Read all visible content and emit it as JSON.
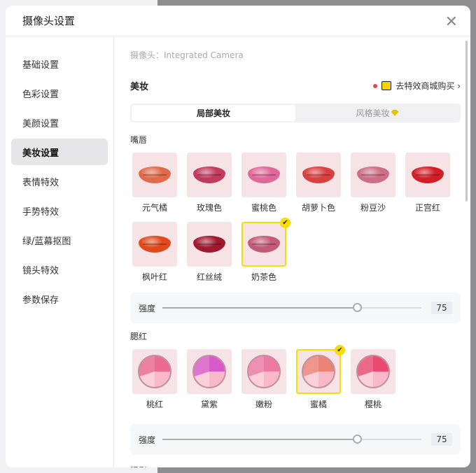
{
  "title": "摄像头设置",
  "sidebar": {
    "items": [
      {
        "label": "基础设置"
      },
      {
        "label": "色彩设置"
      },
      {
        "label": "美颜设置"
      },
      {
        "label": "美妆设置"
      },
      {
        "label": "表情特效"
      },
      {
        "label": "手势特效"
      },
      {
        "label": "绿/蓝幕抠图"
      },
      {
        "label": "镜头特效"
      },
      {
        "label": "参数保存"
      }
    ],
    "active": 3
  },
  "camera": "摄像头：Integrated Camera",
  "section_title": "美妆",
  "shop_link": "去特效商城购买 ›",
  "tabs": [
    {
      "label": "局部美妆"
    },
    {
      "label": "风格美妆"
    }
  ],
  "lips": {
    "title": "嘴唇",
    "items": [
      {
        "label": "元气橘",
        "color": "#e06a4a"
      },
      {
        "label": "玫瑰色",
        "color": "#c23a5c"
      },
      {
        "label": "蜜桃色",
        "color": "#e0679a"
      },
      {
        "label": "胡萝卜色",
        "color": "#d8413f"
      },
      {
        "label": "粉豆沙",
        "color": "#cc6f86"
      },
      {
        "label": "正宫红",
        "color": "#d21e26"
      },
      {
        "label": "枫叶红",
        "color": "#e04a1c"
      },
      {
        "label": "红丝绒",
        "color": "#a01a2e"
      },
      {
        "label": "奶茶色",
        "color": "#c25a7a"
      }
    ],
    "selected": 8,
    "strength_label": "强度",
    "strength": 75
  },
  "blush": {
    "title": "腮红",
    "items": [
      {
        "label": "桃红",
        "color": "#ea6a92"
      },
      {
        "label": "黛紫",
        "color": "#d85ac8"
      },
      {
        "label": "嫩粉",
        "color": "#ec7aa4"
      },
      {
        "label": "蜜橘",
        "color": "#ec8274"
      },
      {
        "label": "樱桃",
        "color": "#ec4a70"
      }
    ],
    "selected": 3,
    "strength_label": "强度",
    "strength": 75
  },
  "next_section": "眼影"
}
